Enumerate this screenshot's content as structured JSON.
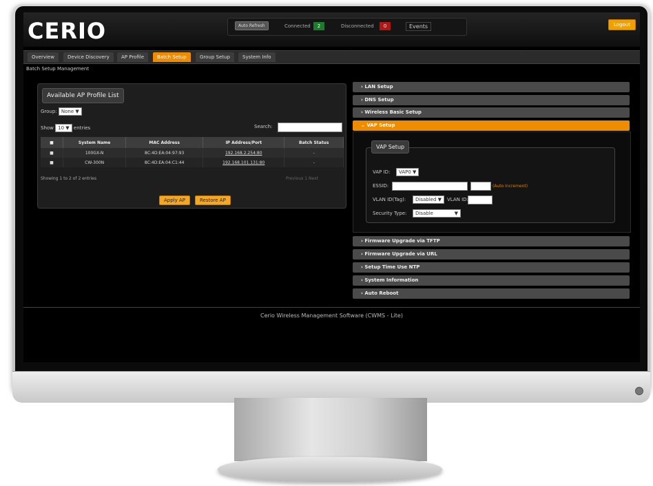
{
  "app": {
    "logo": "CERIO"
  },
  "status": {
    "auto_refresh": "Auto Refresh",
    "connected_label": "Connected",
    "connected_count": "2",
    "disconnected_label": "Disconnected",
    "disconnected_count": "0",
    "events": "Events",
    "logout": "Logout",
    "colors": {
      "connected": "#1e7a2e",
      "disconnected": "#b01818",
      "accent": "#f08c00"
    }
  },
  "menu": {
    "tabs": [
      {
        "label": "Overview"
      },
      {
        "label": "Device Discovery"
      },
      {
        "label": "AP Profile"
      },
      {
        "label": "Batch Setup",
        "active": true
      },
      {
        "label": "Group Setup"
      },
      {
        "label": "System Info"
      }
    ]
  },
  "breadcrumb": "Batch Setup Management",
  "left": {
    "title": "Available AP Profile List",
    "group_label": "Group:",
    "group_value": "None",
    "show_label": "Show",
    "show_value": "10",
    "entries_label": "entries",
    "search_label": "Search:",
    "columns": [
      "System Name",
      "MAC Address",
      "IP Address/Port",
      "Batch Status"
    ],
    "rows": [
      {
        "name": "100GX-N",
        "mac": "8C:4D:EA:04:97:93",
        "ip": "192.168.2.254:80",
        "status": "-"
      },
      {
        "name": "CW-300N",
        "mac": "8C:4D:EA:04:C1:44",
        "ip": "192.168.101.131:80",
        "status": "-"
      }
    ],
    "info": "Showing 1 to 2 of 2 entries",
    "prev": "Previous",
    "next": "Next",
    "apply_btn": "Apply AP",
    "restore_btn": "Restore AP"
  },
  "right": {
    "sections": [
      {
        "label": "LAN Setup"
      },
      {
        "label": "DNS Setup"
      },
      {
        "label": "Wireless Basic Setup"
      },
      {
        "label": "VAP Setup",
        "active": true
      },
      {
        "label": "Firmware Upgrade via TFTP"
      },
      {
        "label": "Firmware Upgrade via URL"
      },
      {
        "label": "Setup Time Use NTP"
      },
      {
        "label": "System Information"
      },
      {
        "label": "Auto Reboot"
      }
    ],
    "vap": {
      "title": "VAP Setup",
      "vap_id_label": "VAP ID:",
      "vap_id_value": "VAP0",
      "essid_label": "ESSID:",
      "auto_inc": "(Auto Increment)",
      "vlan_tag_label": "VLAN ID(Tag):",
      "vlan_tag_value": "Disabled",
      "vlan_id_label": "VLAN ID:",
      "security_label": "Security Type:",
      "security_value": "Disable"
    }
  },
  "footer": "Cerio Wireless Management Software (CWMS - Lite)"
}
